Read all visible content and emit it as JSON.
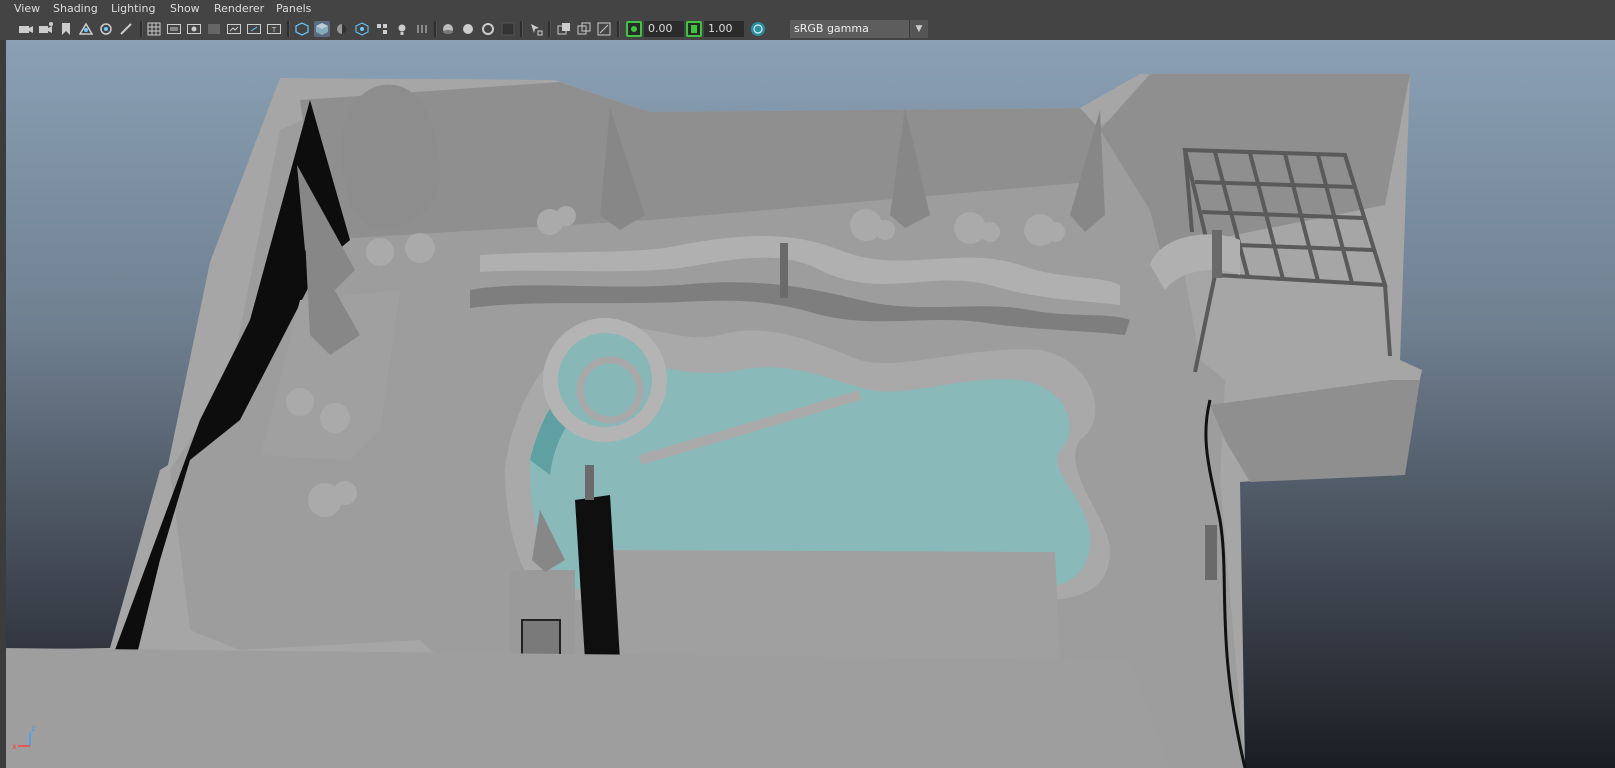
{
  "menu": [
    "View",
    "Shading",
    "Lighting",
    "Show",
    "Renderer",
    "Panels"
  ],
  "toolbar": {
    "exposure_value": "0.00",
    "gamma_value": "1.00",
    "color_space": "sRGB gamma"
  },
  "axis": {
    "z": "z",
    "x": "x"
  },
  "colors": {
    "ui_bg": "#444444",
    "accent_green": "#3ec43e",
    "water": "#8ab9ba"
  },
  "icons": [
    "camera-select-icon",
    "camera-attributes-icon",
    "bookmark-icon",
    "image-plane-icon",
    "grid-icon",
    "film-gate-icon",
    "resolution-gate-icon",
    "gate-mask-icon",
    "field-chart-icon",
    "safe-action-icon",
    "safe-title-icon",
    "wireframe-icon",
    "smooth-shade-icon",
    "default-material-icon",
    "xray-icon",
    "lights-icon",
    "shadows-icon",
    "ambient-occlusion-icon",
    "antialiasing-icon",
    "isolate-select-icon",
    "xray-joints-icon",
    "exposure-icon",
    "gamma-icon",
    "color-management-icon"
  ]
}
